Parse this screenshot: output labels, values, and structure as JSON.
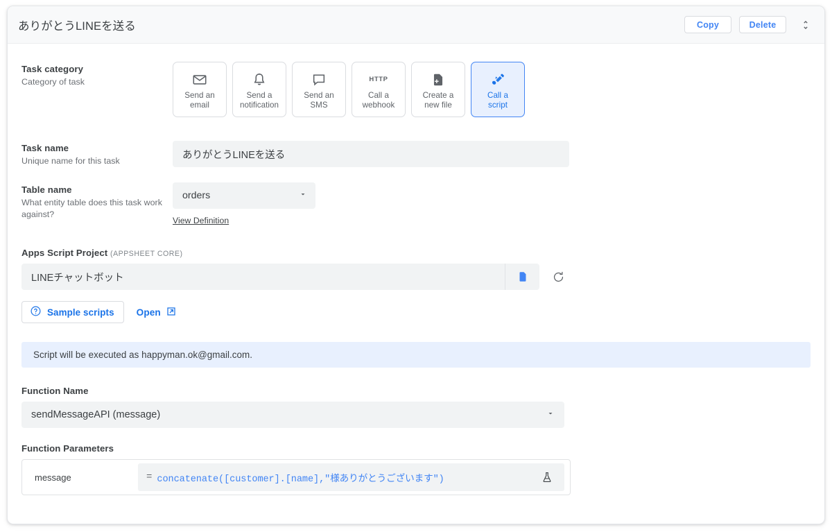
{
  "header": {
    "title": "ありがとうLINEを送る",
    "copy_label": "Copy",
    "delete_label": "Delete",
    "expander_icon": "unfold-more-icon"
  },
  "task_category": {
    "label": "Task category",
    "description": "Category of task",
    "tiles": [
      {
        "icon": "envelope-icon",
        "line1": "Send an",
        "line2": "email",
        "selected": false
      },
      {
        "icon": "bell-icon",
        "line1": "Send a",
        "line2": "notification",
        "selected": false
      },
      {
        "icon": "speech-bubble-icon",
        "line1": "Send an",
        "line2": "SMS",
        "selected": false
      },
      {
        "icon": "http-text-icon",
        "icon_text": "HTTP",
        "line1": "Call a",
        "line2": "webhook",
        "selected": false
      },
      {
        "icon": "file-plus-icon",
        "line1": "Create a",
        "line2": "new file",
        "selected": false
      },
      {
        "icon": "script-icon",
        "line1": "Call a",
        "line2": "script",
        "selected": true
      }
    ]
  },
  "task_name": {
    "label": "Task name",
    "description": "Unique name for this task",
    "value": "ありがとうLINEを送る"
  },
  "table_name": {
    "label": "Table name",
    "description": "What entity table does this task work against?",
    "value": "orders",
    "view_definition_label": "View Definition"
  },
  "apps_script_project": {
    "label": "Apps Script Project",
    "hint": "(APPSHEET CORE)",
    "value": "LINEチャットボット",
    "doc_icon": "document-icon",
    "refresh_icon": "refresh-icon",
    "sample_scripts_label": "Sample scripts",
    "sample_scripts_icon": "help-circle-icon",
    "open_label": "Open",
    "open_icon": "external-link-icon"
  },
  "info_banner": {
    "text": "Script will be executed as happyman.ok@gmail.com."
  },
  "function_name": {
    "label": "Function Name",
    "value": "sendMessageAPI (message)"
  },
  "function_parameters": {
    "label": "Function Parameters",
    "rows": [
      {
        "name": "message",
        "equals": "=",
        "formula": "concatenate([customer].[name],\"様ありがとうございます\")",
        "flask_icon": "flask-icon"
      }
    ]
  },
  "colors": {
    "accent_blue": "#1a73e8",
    "link_blue": "#4285f4",
    "selected_bg": "#e8f0fe",
    "field_bg": "#f1f3f4",
    "header_bg": "#f8f9fa",
    "text_primary": "#3c4043",
    "text_secondary": "#5f6368"
  }
}
